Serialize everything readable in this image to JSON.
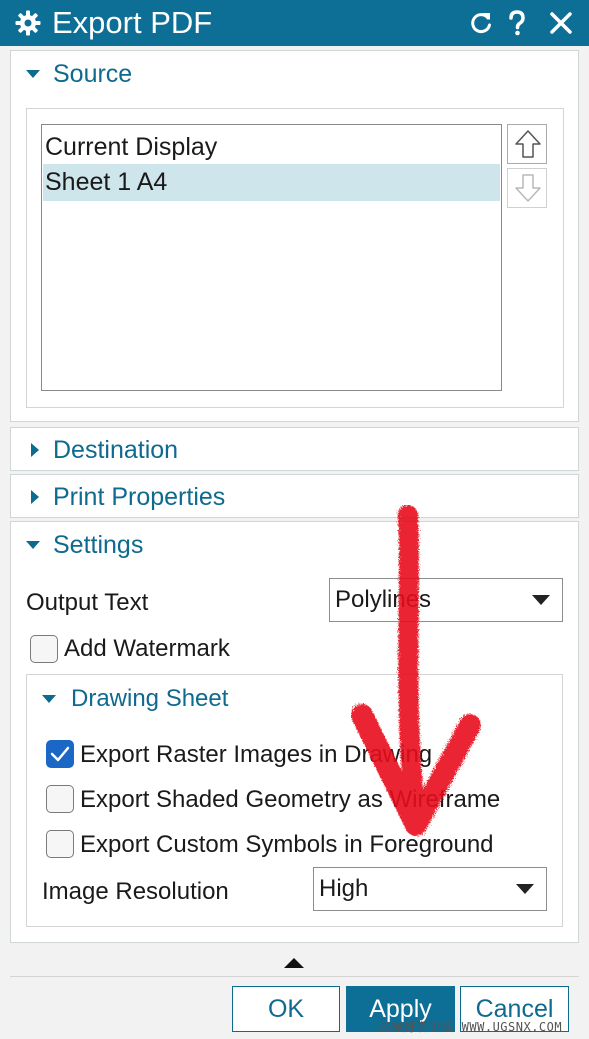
{
  "window": {
    "title": "Export PDF"
  },
  "source": {
    "header": "Source",
    "items": [
      {
        "label": "Current Display",
        "selected": false
      },
      {
        "label": "Sheet 1  A4",
        "selected": true
      }
    ]
  },
  "destination": {
    "header": "Destination"
  },
  "print_properties": {
    "header": "Print Properties"
  },
  "settings": {
    "header": "Settings",
    "output_text_label": "Output Text",
    "output_text_value": "Polylines",
    "add_watermark_label": "Add Watermark",
    "add_watermark_checked": false,
    "drawing_sheet": {
      "header": "Drawing Sheet",
      "export_raster_label": "Export Raster Images in Drawing",
      "export_raster_checked": true,
      "export_shaded_label": "Export Shaded Geometry as Wireframe",
      "export_shaded_checked": false,
      "export_custom_label": "Export Custom Symbols in Foreground",
      "export_custom_checked": false,
      "image_resolution_label": "Image Resolution",
      "image_resolution_value": "High"
    }
  },
  "buttons": {
    "ok": "OK",
    "apply": "Apply",
    "cancel": "Cancel"
  },
  "watermark_text": "UG爱好者论坛 WWW.UGSNX.COM",
  "colors": {
    "accent": "#0e6f96",
    "selection": "#cfe5ec",
    "annotation_arrow": "#e8101c"
  }
}
